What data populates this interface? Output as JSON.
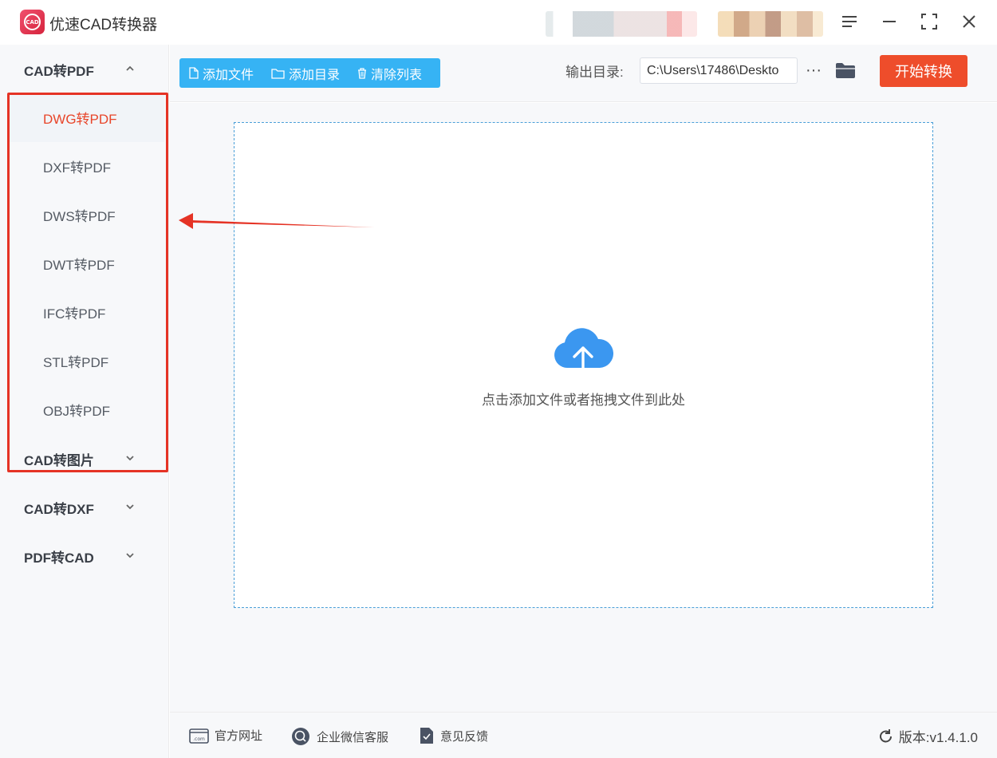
{
  "window": {
    "title": "优速CAD转换器",
    "logo_text": "CAD"
  },
  "sidebar": {
    "groups": [
      {
        "label": "CAD转PDF",
        "expanded": true,
        "items": [
          {
            "label": "DWG转PDF",
            "active": true
          },
          {
            "label": "DXF转PDF"
          },
          {
            "label": "DWS转PDF"
          },
          {
            "label": "DWT转PDF"
          },
          {
            "label": "IFC转PDF"
          },
          {
            "label": "STL转PDF"
          },
          {
            "label": "OBJ转PDF"
          }
        ]
      },
      {
        "label": "CAD转图片",
        "expanded": false
      },
      {
        "label": "CAD转DXF",
        "expanded": false
      },
      {
        "label": "PDF转CAD",
        "expanded": false
      }
    ]
  },
  "toolbar": {
    "add_file": "添加文件",
    "add_dir": "添加目录",
    "clear_list": "清除列表",
    "output_label": "输出目录:",
    "output_path": "C:\\Users\\17486\\Deskto",
    "more": "···",
    "start": "开始转换"
  },
  "main": {
    "drop_hint": "点击添加文件或者拖拽文件到此处"
  },
  "footer": {
    "website": "官方网址",
    "wechat": "企业微信客服",
    "feedback": "意见反馈",
    "version": "版本:v1.4.1.0"
  },
  "colors": {
    "accent_blue": "#36b3f4",
    "start_orange": "#ee4d2b",
    "active_red": "#e8462b",
    "highlight_frame": "#e53325"
  }
}
